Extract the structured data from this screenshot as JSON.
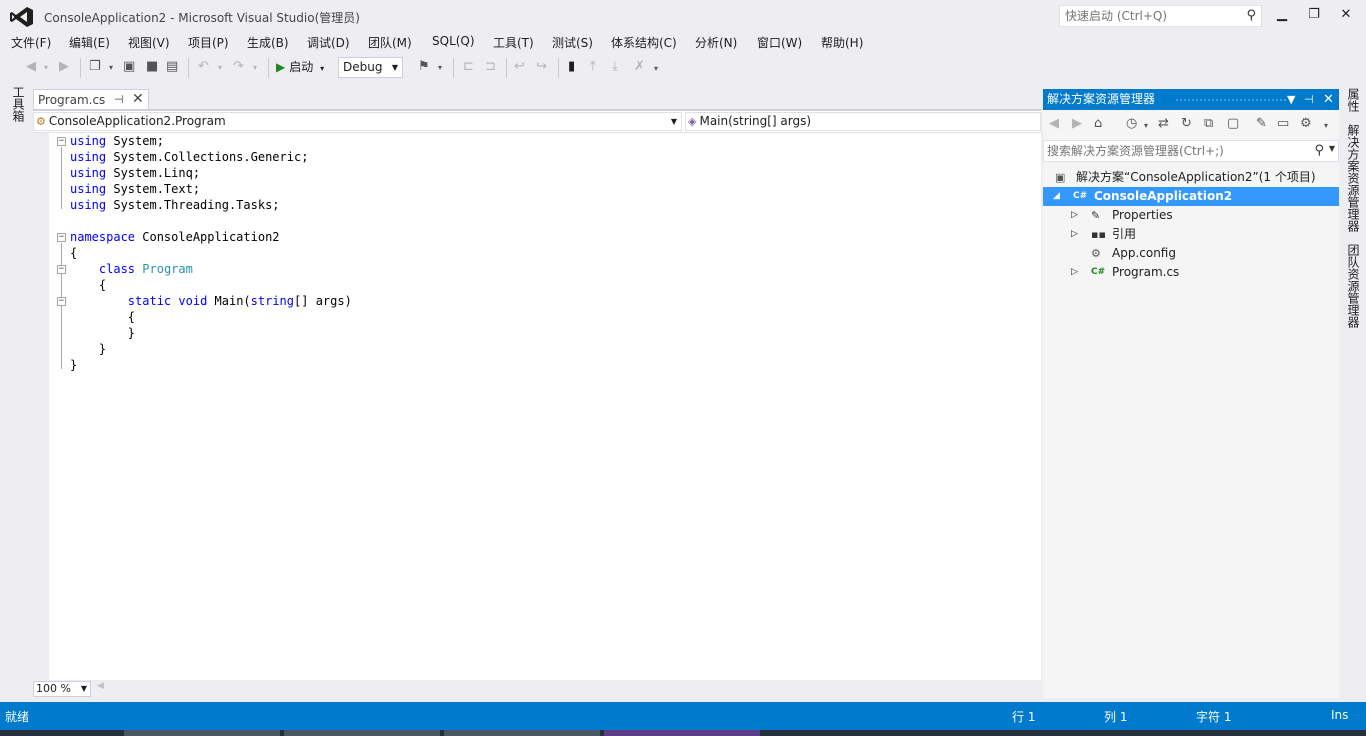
{
  "window": {
    "title": "ConsoleApplication2 - Microsoft Visual Studio(管理员)",
    "quick_launch_placeholder": "快速启动 (Ctrl+Q)",
    "minimize": "▁",
    "restore": "❐",
    "close": "✕"
  },
  "menu": [
    "文件(F)",
    "编辑(E)",
    "视图(V)",
    "项目(P)",
    "生成(B)",
    "调试(D)",
    "团队(M)",
    "SQL(Q)",
    "工具(T)",
    "测试(S)",
    "体系结构(C)",
    "分析(N)",
    "窗口(W)",
    "帮助(H)"
  ],
  "toolbar": {
    "start_label": "启动",
    "config_value": "Debug"
  },
  "toolbox_label": "工具箱",
  "document": {
    "tab_label": "Program.cs",
    "tab_pin": "⊣",
    "tab_close": "✕",
    "nav_class": "ConsoleApplication2.Program",
    "nav_member": "Main(string[] args)"
  },
  "code": {
    "lines": [
      [
        [
          "kw",
          "using"
        ],
        [
          "pl",
          " System;"
        ]
      ],
      [
        [
          "kw",
          "using"
        ],
        [
          "pl",
          " System.Collections.Generic;"
        ]
      ],
      [
        [
          "kw",
          "using"
        ],
        [
          "pl",
          " System.Linq;"
        ]
      ],
      [
        [
          "kw",
          "using"
        ],
        [
          "pl",
          " System.Text;"
        ]
      ],
      [
        [
          "kw",
          "using"
        ],
        [
          "pl",
          " System.Threading.Tasks;"
        ]
      ],
      [],
      [
        [
          "kw",
          "namespace"
        ],
        [
          "pl",
          " ConsoleApplication2"
        ]
      ],
      [
        [
          "pl",
          "{"
        ]
      ],
      [
        [
          "pl",
          "    "
        ],
        [
          "kw",
          "class"
        ],
        [
          "pl",
          " "
        ],
        [
          "ty",
          "Program"
        ]
      ],
      [
        [
          "pl",
          "    {"
        ]
      ],
      [
        [
          "pl",
          "        "
        ],
        [
          "kw",
          "static"
        ],
        [
          "pl",
          " "
        ],
        [
          "kw",
          "void"
        ],
        [
          "pl",
          " Main("
        ],
        [
          "kw",
          "string"
        ],
        [
          "pl",
          "[] args)"
        ]
      ],
      [
        [
          "pl",
          "        {"
        ]
      ],
      [
        [
          "pl",
          "        }"
        ]
      ],
      [
        [
          "pl",
          "    }"
        ]
      ],
      [
        [
          "pl",
          "}"
        ]
      ]
    ]
  },
  "editor": {
    "zoom": "100 %"
  },
  "solution_explorer": {
    "title": "解决方案资源管理器",
    "search_placeholder": "搜索解决方案资源管理器(Ctrl+;)",
    "tree": [
      {
        "label": "解决方案“ConsoleApplication2”(1 个项目)",
        "icon": "solution-icon",
        "level": 0,
        "arrow": "",
        "selected": false
      },
      {
        "label": "ConsoleApplication2",
        "icon": "csharp-project-icon",
        "level": 1,
        "arrow": "◢",
        "selected": true
      },
      {
        "label": "Properties",
        "icon": "wrench-icon",
        "level": 2,
        "arrow": "▷",
        "selected": false
      },
      {
        "label": "引用",
        "icon": "references-icon",
        "level": 2,
        "arrow": "▷",
        "selected": false
      },
      {
        "label": "App.config",
        "icon": "config-file-icon",
        "level": 2,
        "arrow": "",
        "selected": false
      },
      {
        "label": "Program.cs",
        "icon": "csharp-file-icon",
        "level": 2,
        "arrow": "▷",
        "selected": false
      }
    ]
  },
  "right_tabs": [
    "属性",
    "解决方案资源管理器",
    "团队资源管理器"
  ],
  "status": {
    "ready": "就绪",
    "line": "行 1",
    "column": "列 1",
    "char": "字符 1",
    "mode": "Ins"
  },
  "colors": {
    "accent": "#007acc",
    "selection": "#3399ff",
    "keyword": "#0000ff",
    "type": "#2b91af"
  }
}
